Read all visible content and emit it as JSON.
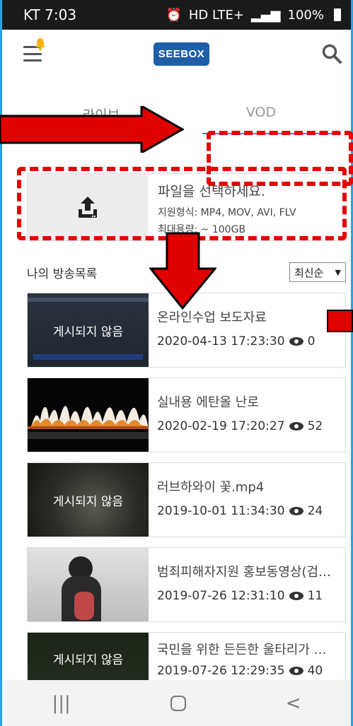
{
  "status": {
    "carrier_time": "KT 7:03",
    "network": "HD LTE+",
    "battery": "100%"
  },
  "header": {
    "logo": "SEEBOX"
  },
  "tabs": [
    {
      "label": "라이브"
    },
    {
      "label": "VOD"
    }
  ],
  "upload": {
    "title": "파일을 선택하세요.",
    "formats": "지원형식: MP4, MOV, AVI, FLV",
    "max_size": "최대용량: ~ 100GB"
  },
  "list": {
    "title": "나의 방송목록",
    "sort": "최신순"
  },
  "items": [
    {
      "title": "온라인수업 보도자료",
      "datetime": "2020-04-13 17:23:30",
      "views": "0",
      "overlay": "게시되지 않음"
    },
    {
      "title": "실내용 에탄올 난로",
      "datetime": "2020-02-19 17:20:27",
      "views": "52",
      "overlay": ""
    },
    {
      "title": "러브하와이 꽃.mp4",
      "datetime": "2019-10-01 11:34:30",
      "views": "24",
      "overlay": "게시되지 않음"
    },
    {
      "title": "범죄피해자지원 홍보동영상(검…",
      "datetime": "2019-07-26 12:31:10",
      "views": "11",
      "overlay": ""
    },
    {
      "title": "국민을 위한 든든한 울타리가 …",
      "datetime": "2019-07-26 12:29:35",
      "views": "40",
      "overlay": "게시되지 않음"
    }
  ],
  "colors": {
    "accent": "#3a8fd0",
    "logo_bg": "#1e5fa8",
    "annotation": "#e60000"
  }
}
